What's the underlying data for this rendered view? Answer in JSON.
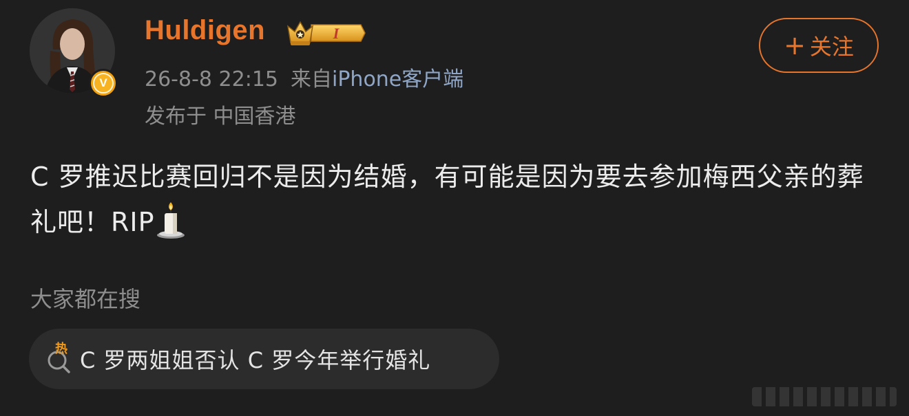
{
  "user": {
    "name": "Huldigen",
    "level_badge": "I",
    "verified_badge_letter": "V"
  },
  "meta": {
    "time": "26-8-8 22:15",
    "source_prefix": "来自",
    "device": "iPhone客户端",
    "location": "发布于 中国香港"
  },
  "follow_button": {
    "plus": "+",
    "label": "关注"
  },
  "post": {
    "text": "C 罗推迟比赛回归不是因为结婚，有可能是因为要去参加梅西父亲的葬礼吧！RIP",
    "emoji_icon": "candle-icon"
  },
  "search_section": {
    "heading": "大家都在搜",
    "hot_mark": "热",
    "query": "C 罗两姐姐否认 C 罗今年举行婚礼"
  },
  "colors": {
    "background": "#1e1e1e",
    "accent_orange": "#e8752c",
    "meta_gray": "#8e8e8e",
    "device_blue": "#8fa6c6",
    "pill_bg": "#2c2c2c"
  }
}
